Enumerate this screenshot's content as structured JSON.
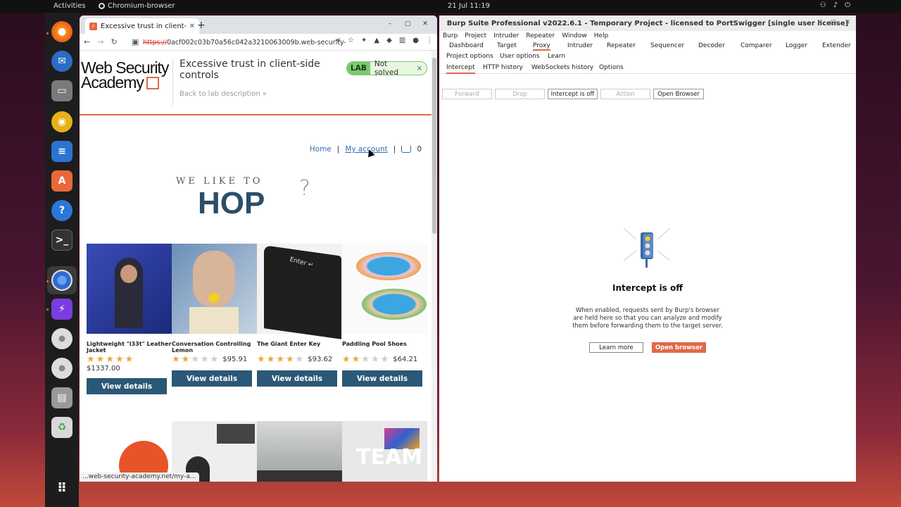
{
  "topbar": {
    "activities": "Activities",
    "app_name": "Chromium-browser",
    "clock": "21 Jul  11:19"
  },
  "browser": {
    "tab_title": "Excessive trust in client-si",
    "url_proto": "https://",
    "url_rest": "0acf002c03b70a56c042a3210063009b.web-security-a...",
    "status_url": "...web-security-academy.net/my-a..."
  },
  "lab": {
    "logo_line1": "Web Security",
    "logo_line2": "Academy",
    "title": "Excessive trust in client-side controls",
    "back_link": "Back to lab description  »",
    "badge_label": "LAB",
    "badge_status": "Not solved",
    "badge_close": "×"
  },
  "nav": {
    "home": "Home",
    "sep1": "|",
    "my_account": "My account",
    "sep2": "|",
    "cart_count": "0"
  },
  "hero": {
    "line1": "WE LIKE TO",
    "line2": "HOP"
  },
  "products": [
    {
      "name": "Lightweight \"l33t\" Leather Jacket",
      "rating": 5,
      "price": "$1337.00",
      "button": "View details"
    },
    {
      "name": "Conversation Controlling Lemon",
      "rating": 2,
      "price": "$95.91",
      "button": "View details"
    },
    {
      "name": "The Giant Enter Key",
      "rating": 4,
      "price": "$93.62",
      "button": "View details"
    },
    {
      "name": "Paddling Pool Shoes",
      "rating": 2,
      "price": "$64.21",
      "button": "View details"
    }
  ],
  "burp": {
    "title": "Burp Suite Professional v2022.6.1 - Temporary Project - licensed to PortSwigger [single user license]",
    "menu": [
      "Burp",
      "Project",
      "Intruder",
      "Repeater",
      "Window",
      "Help"
    ],
    "tabs_row1": [
      "Dashboard",
      "Target",
      "Proxy",
      "Intruder",
      "Repeater",
      "Sequencer",
      "Decoder",
      "Comparer",
      "Logger",
      "Extender"
    ],
    "tabs_row2": [
      "Project options",
      "User options",
      "Learn"
    ],
    "subtabs": [
      "Intercept",
      "HTTP history",
      "WebSockets history",
      "Options"
    ],
    "buttons": [
      "Forward",
      "Drop",
      "Intercept is off",
      "Action",
      "Open Browser"
    ],
    "intercept_title": "Intercept is off",
    "intercept_desc": "When enabled, requests sent by Burp's browser are held here so that you can analyze and modify them before forwarding them to the target server.",
    "learn_more": "Learn more",
    "open_browser": "Open browser",
    "accent": "#e0694a"
  }
}
